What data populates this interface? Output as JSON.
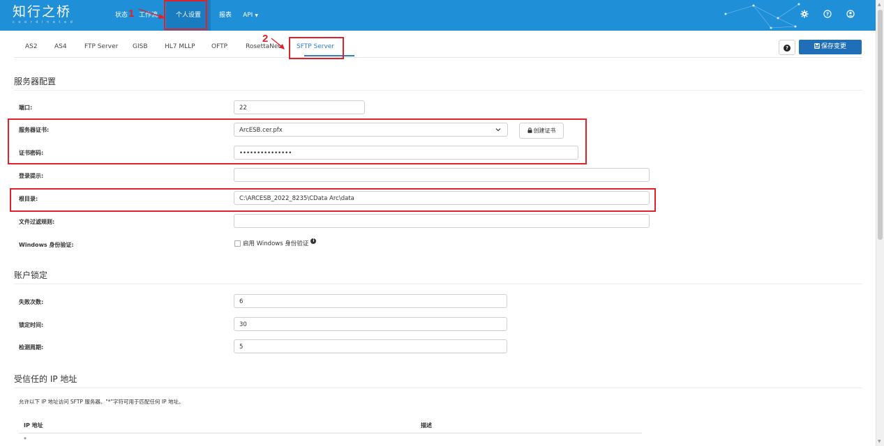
{
  "app": {
    "logo": "知行之桥",
    "logo_sub": "c o o r d i n a t e d",
    "nav": [
      {
        "label": "状态"
      },
      {
        "label": "工作流"
      },
      {
        "label": "个人设置"
      },
      {
        "label": "报表"
      },
      {
        "label": "API"
      }
    ],
    "top_icons": [
      "gear-icon",
      "help-circle-icon",
      "user-icon"
    ]
  },
  "tabs": [
    "AS2",
    "AS4",
    "FTP Server",
    "GISB",
    "HL7 MLLP",
    "OFTP",
    "RosettaNet",
    "SFTP Server"
  ],
  "active_tab": "SFTP Server",
  "toolbar": {
    "help": "?",
    "save_label": "保存变更"
  },
  "server_config": {
    "title": "服务器配置",
    "port_label": "端口:",
    "port_value": "22",
    "cert_label": "服务器证书:",
    "cert_value": "ArcESB.cer.pfx",
    "create_cert_label": "创建证书",
    "password_label": "证书密码:",
    "password_value": "•••••••••••••••",
    "login_prompt_label": "登录提示:",
    "login_prompt_value": "",
    "root_label": "根目录:",
    "root_value": "C:\\ARCESB_2022_8235\\CData Arc\\data",
    "filter_label": "文件过滤规则:",
    "filter_value": "",
    "windows_auth_label": "Windows 身份验证:",
    "windows_auth_checkbox": "启用 Windows 身份验证",
    "windows_auth_checked": false
  },
  "lockout": {
    "title": "账户锁定",
    "attempts_label": "失败次数:",
    "attempts_value": "6",
    "lock_time_label": "锁定时间:",
    "lock_time_value": "30",
    "detect_period_label": "检测周期:",
    "detect_period_value": "5"
  },
  "trusted_ip": {
    "title": "受信任的 IP 地址",
    "description": "允许以下 IP 地址访问 SFTP 服务器。\"*\"字符可用于匹配任何 IP 地址。",
    "columns": [
      "IP 地址",
      "描述"
    ],
    "rows": [
      {
        "ip": "*",
        "desc": ""
      }
    ]
  },
  "annotations": {
    "step1": "1",
    "step2": "2",
    "highlight_color": "#e0202a"
  },
  "colors": {
    "topbar": "#1f8fd8",
    "accent": "#2a7fc8",
    "save_button": "#1e6fb8"
  }
}
